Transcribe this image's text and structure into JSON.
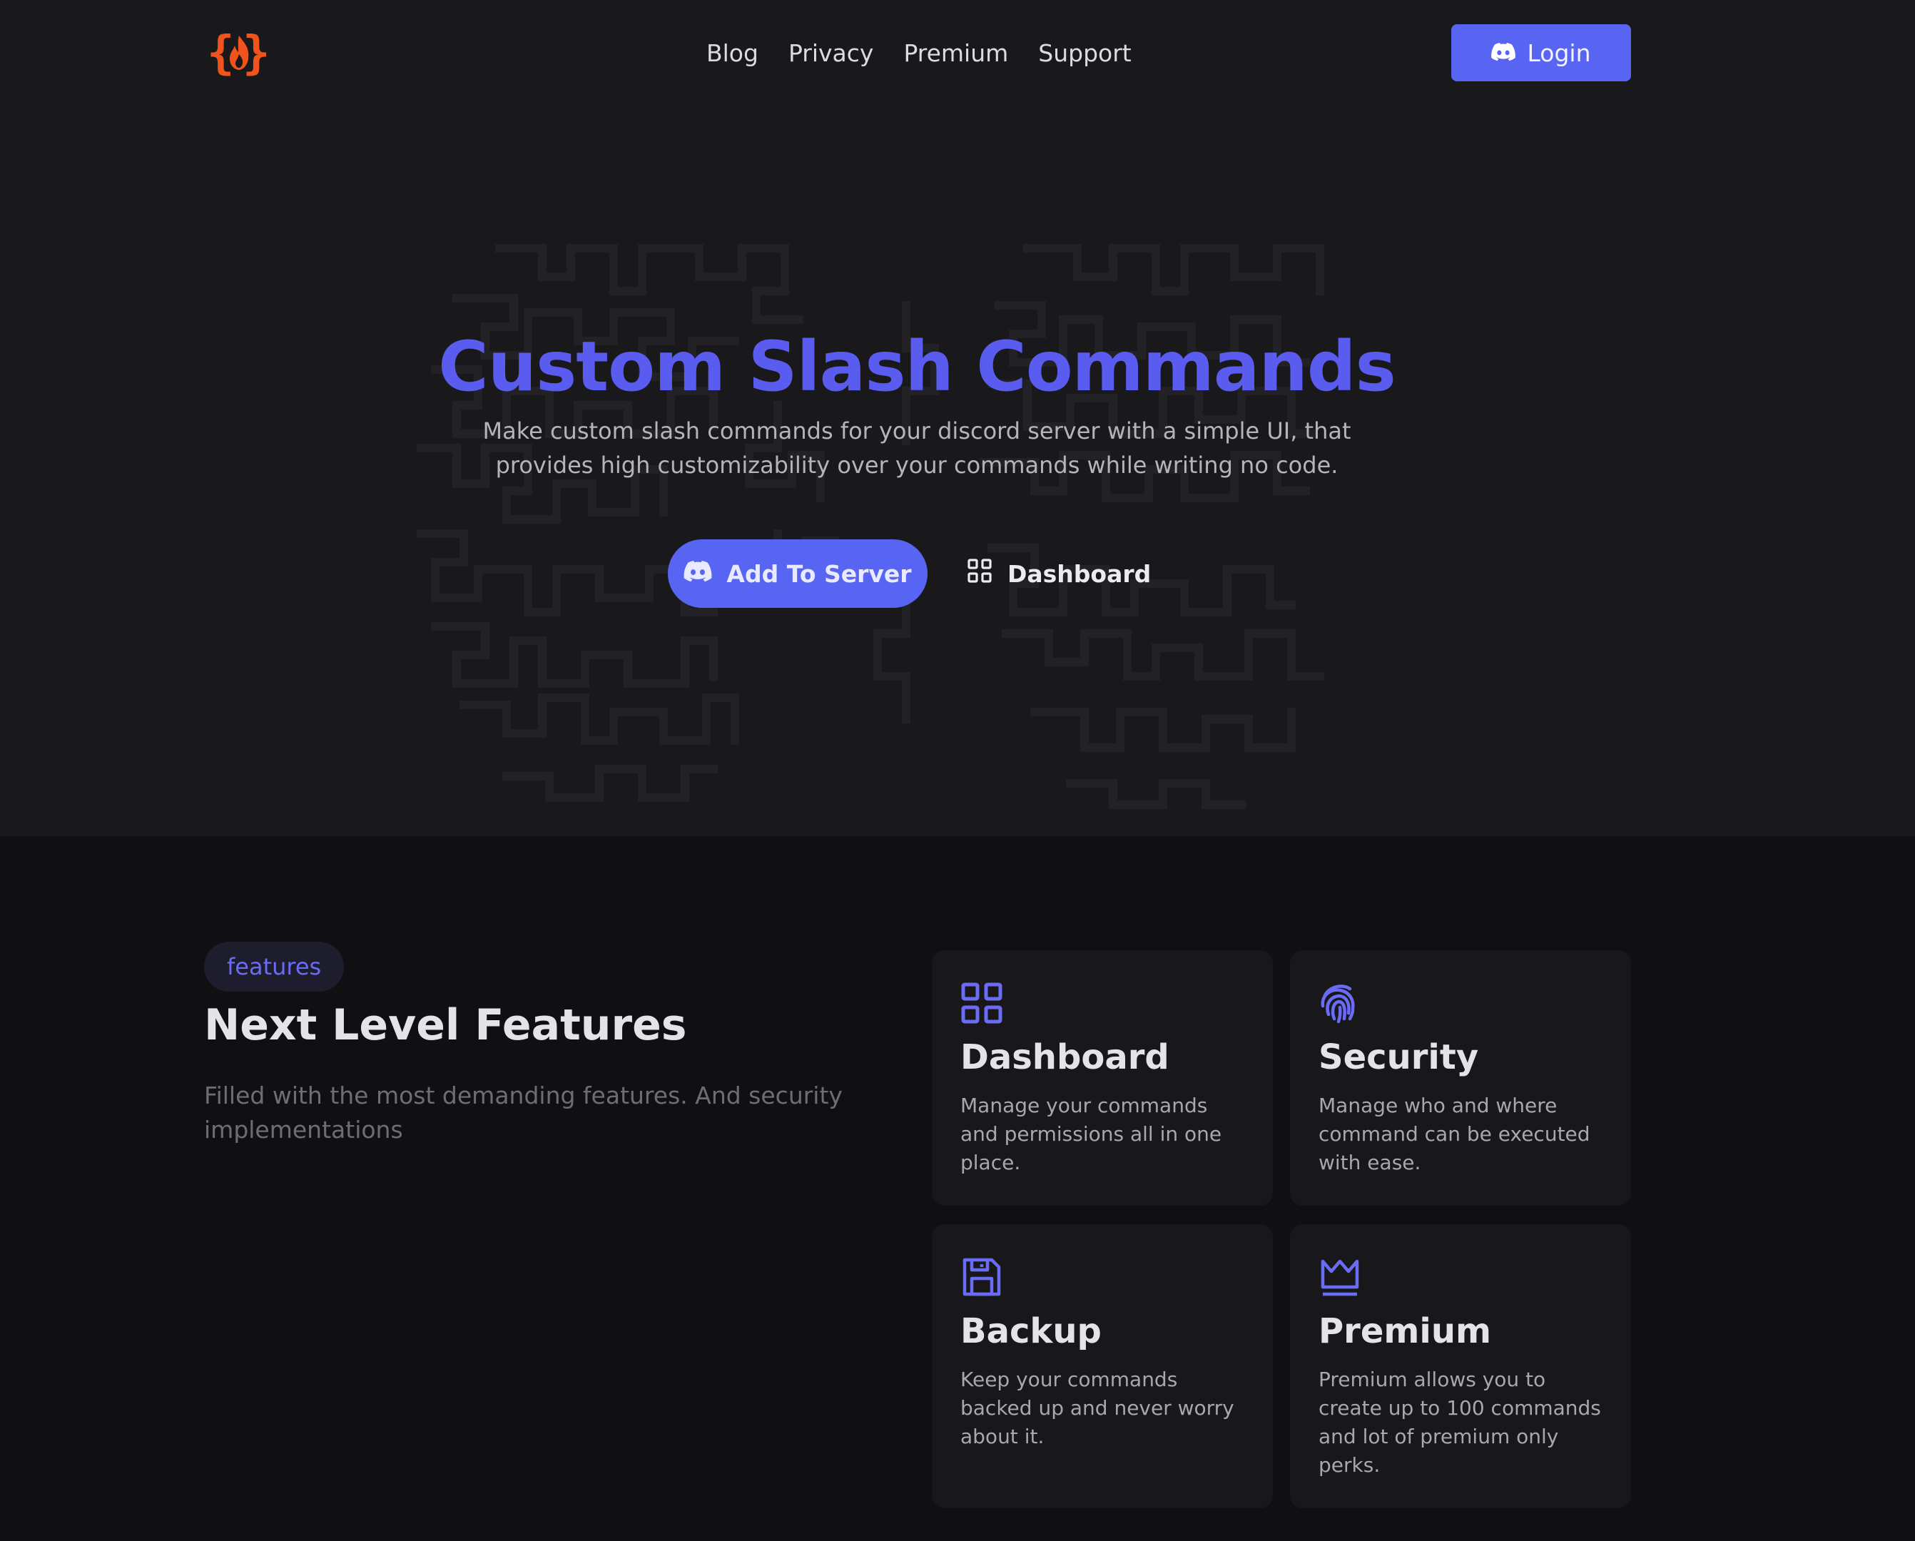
{
  "nav": {
    "logo_icon": "code-fire-logo-icon",
    "links": [
      "Blog",
      "Privacy",
      "Premium",
      "Support"
    ],
    "login_label": "Login",
    "login_icon": "discord-icon"
  },
  "hero": {
    "title": "Custom Slash Commands",
    "subtitle": "Make custom slash commands for your discord server with a simple UI, that provides high customizability over your commands while writing no code.",
    "add_button_label": "Add To Server",
    "add_button_icon": "discord-icon",
    "dashboard_button_label": "Dashboard",
    "dashboard_button_icon": "grid-icon"
  },
  "features": {
    "pill": "features",
    "heading": "Next Level Features",
    "description": "Filled with the most demanding features. And security implementations",
    "cards": [
      {
        "icon": "grid-icon",
        "title": "Dashboard",
        "text": "Manage your commands and permissions all in one place."
      },
      {
        "icon": "fingerprint-icon",
        "title": "Security",
        "text": "Manage who and where command can be executed with ease."
      },
      {
        "icon": "floppy-disk-icon",
        "title": "Backup",
        "text": "Keep your commands backed up and never worry about it."
      },
      {
        "icon": "crown-icon",
        "title": "Premium",
        "text": "Premium allows you to create up to 100 commands and lot of premium only perks."
      }
    ]
  },
  "colors": {
    "accent": "#5865f2",
    "title": "#5a5cf0",
    "logo": "#f0531c",
    "hero_bg": "#19191c",
    "features_bg": "#101013",
    "card_bg": "#18181b"
  }
}
